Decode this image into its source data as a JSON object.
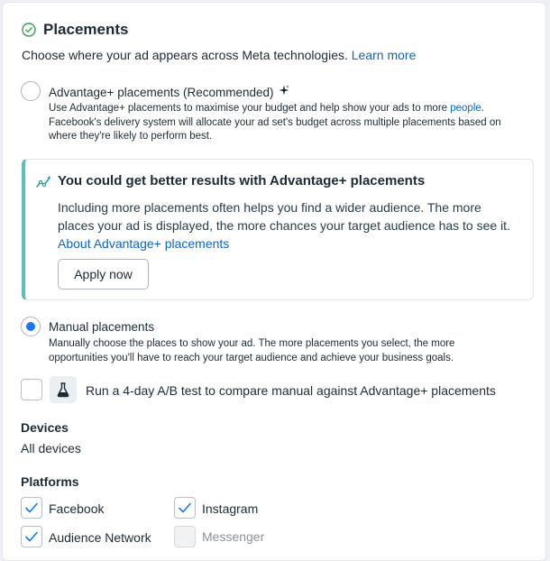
{
  "section": {
    "title": "Placements",
    "subtitle": "Choose where your ad appears across Meta technologies.",
    "learn_more": "Learn more"
  },
  "advantage": {
    "label": "Advantage+ placements (Recommended)",
    "desc_1": "Use Advantage+ placements to maximise your budget and help show your ads to more ",
    "desc_link": "people",
    "desc_2": ".",
    "desc_3": "Facebook's delivery system will allocate your ad set's budget across multiple placements based on",
    "desc_4": "where they're likely to perform best.",
    "selected": false
  },
  "banner": {
    "title": "You could get better results with Advantage+ placements",
    "text": "Including more placements often helps you find a wider audience. The more places your ad is displayed, the more chances your target audience has to see it. ",
    "link": "About Advantage+ placements",
    "button": "Apply now",
    "accent": "#59c2b5"
  },
  "manual": {
    "label": "Manual placements",
    "desc_1": "Manually choose the places to show your ad. The more placements you select, the more",
    "desc_2": "opportunities you'll have to reach your target audience and achieve your business goals.",
    "selected": true
  },
  "ab_test": {
    "label": "Run a 4-day A/B test to compare manual against Advantage+ placements",
    "checked": false,
    "icon": "flask-icon"
  },
  "devices": {
    "heading": "Devices",
    "value": "All devices"
  },
  "platforms": {
    "heading": "Platforms",
    "items": [
      {
        "label": "Facebook",
        "checked": true,
        "disabled": false
      },
      {
        "label": "Instagram",
        "checked": true,
        "disabled": false
      },
      {
        "label": "Audience Network",
        "checked": true,
        "disabled": false
      },
      {
        "label": "Messenger",
        "checked": false,
        "disabled": true
      }
    ]
  },
  "colors": {
    "accent_blue": "#1877f2",
    "link_blue": "#0a66c2",
    "text": "#1c2b33"
  }
}
